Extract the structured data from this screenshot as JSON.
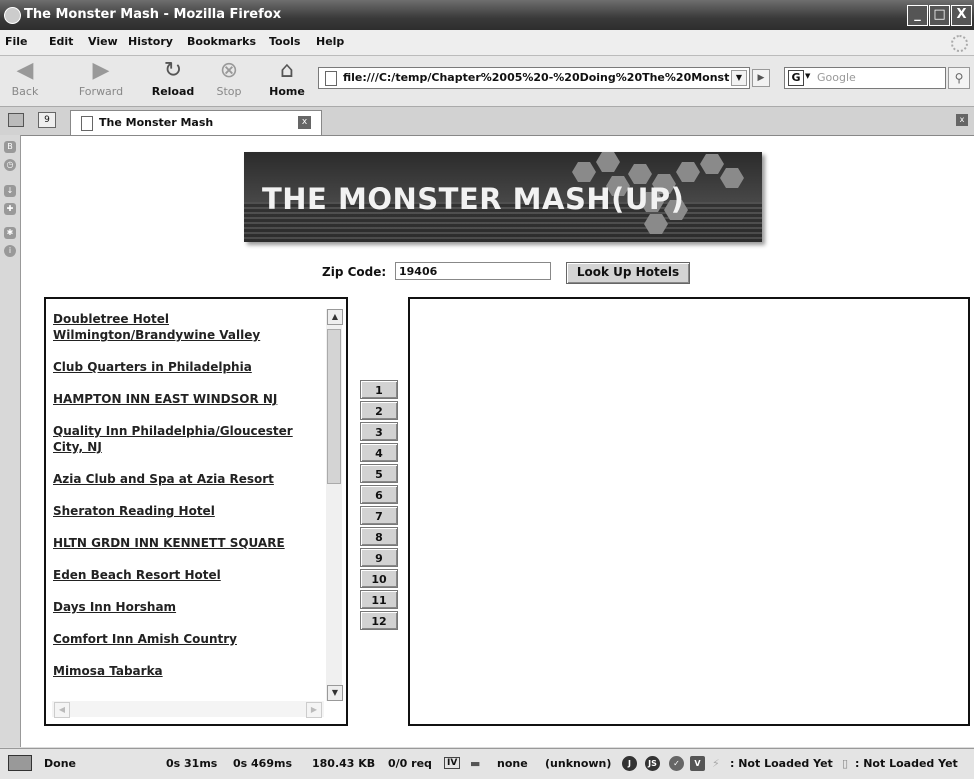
{
  "window": {
    "title": "The Monster Mash - Mozilla Firefox",
    "min_label": "_",
    "max_label": "□",
    "close_label": "X"
  },
  "menu": [
    {
      "label": "File"
    },
    {
      "label": "Edit"
    },
    {
      "label": "View"
    },
    {
      "label": "History"
    },
    {
      "label": "Bookmarks"
    },
    {
      "label": "Tools"
    },
    {
      "label": "Help"
    }
  ],
  "nav": {
    "back": "Back",
    "forward": "Forward",
    "reload": "Reload",
    "stop": "Stop",
    "home": "Home",
    "url": "file:///C:/temp/Chapter%2005%20-%20Doing%20The%20Monst",
    "search_engine": "G",
    "search_placeholder": "Google"
  },
  "tabs": [
    {
      "label": "The Monster Mash"
    }
  ],
  "page": {
    "banner_title": "THE MONSTER MASH(UP)",
    "zip_label": "Zip Code:",
    "zip_value": "19406",
    "lookup_button": "Look Up Hotels",
    "hotels": [
      "Doubletree Hotel Wilmington/Brandywine Valley",
      "Club Quarters in Philadelphia",
      "HAMPTON INN EAST WINDSOR NJ",
      "Quality Inn Philadelphia/Gloucester City, NJ",
      "Azia Club and Spa at Azia Resort",
      "Sheraton Reading Hotel",
      "HLTN GRDN INN KENNETT SQUARE",
      "Eden Beach Resort Hotel",
      "Days Inn Horsham",
      "Comfort Inn Amish Country",
      "Mimosa Tabarka"
    ],
    "page_buttons": [
      "1",
      "2",
      "3",
      "4",
      "5",
      "6",
      "7",
      "8",
      "9",
      "10",
      "11",
      "12"
    ]
  },
  "status": {
    "done": "Done",
    "t1": "0s 31ms",
    "t2": "0s 469ms",
    "size": "180.43 KB",
    "req": "0/0 req",
    "none": "none",
    "unknown": "(unknown)",
    "nl1": ": Not Loaded Yet",
    "nl2": ": Not Loaded Yet"
  }
}
